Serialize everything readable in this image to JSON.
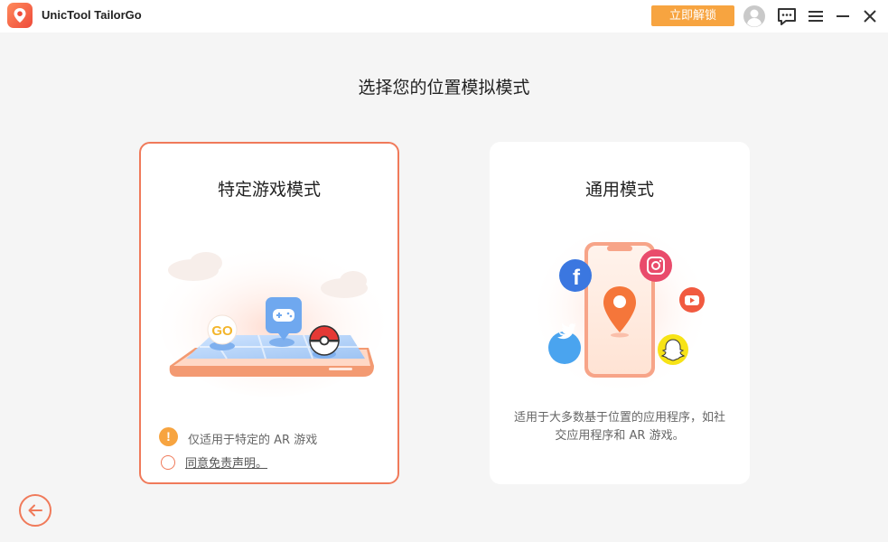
{
  "app": {
    "title": "UnicTool TailorGo",
    "unlock_label": "立即解锁",
    "accent": "#f07a5a",
    "unlock_color": "#f7a440"
  },
  "titlebar_icons": [
    "user-avatar-icon",
    "feedback-icon",
    "menu-icon",
    "minimize-icon",
    "close-icon"
  ],
  "main": {
    "heading": "选择您的位置模拟模式"
  },
  "cards": {
    "game": {
      "title": "特定游戏模式",
      "go_badge": "GO",
      "warning": "仅适用于特定的 AR 游戏",
      "agree": "同意免责声明。"
    },
    "general": {
      "title": "通用模式",
      "desc_line1": "适用于大多数基于位置的应用程序，如社",
      "desc_line2": "交应用程序和 AR 游戏。",
      "app_icons": [
        "facebook-icon",
        "instagram-icon",
        "youtube-icon",
        "twitter-icon",
        "snapchat-icon",
        "location-pin-icon"
      ]
    }
  },
  "nav": {
    "back_icon": "back-arrow-icon"
  }
}
